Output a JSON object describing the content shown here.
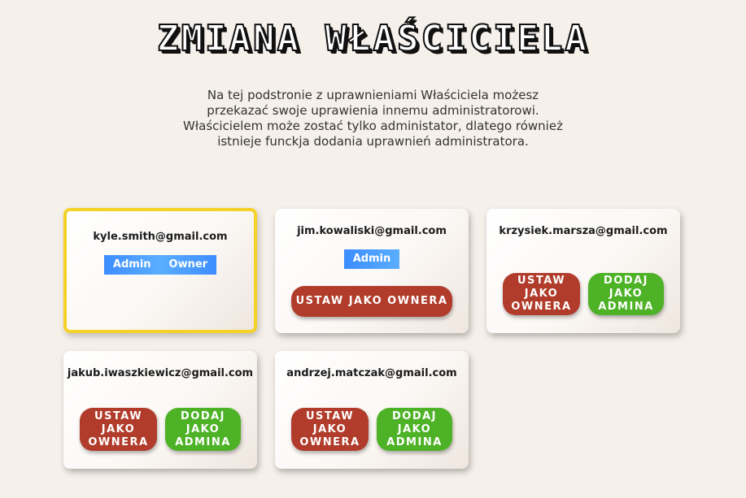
{
  "page": {
    "title": "ZMIANA WŁAŚCICIELA",
    "intro_lines": [
      "Na tej podstronie z uprawnieniami Właściciela możesz",
      "przekazać swoje uprawienia innemu administratorowi.",
      "Właścicielem może zostać tylko administator, dlatego również",
      "istnieje funckja dodania uprawnień administratora."
    ]
  },
  "colors": {
    "owner_border": "#f5d228",
    "set_owner_button": "#b13c2b",
    "add_admin_button": "#4db226",
    "badge": "#3d8dff"
  },
  "users": [
    {
      "email": "kyle.smith@gmail.com",
      "badges": [
        "Admin",
        "Owner"
      ],
      "is_owner": true
    },
    {
      "email": "jim.kowaliski@gmail.com",
      "badges": [
        "Admin"
      ],
      "set_owner_label": "USTAW JAKO OWNERA"
    },
    {
      "email": "krzysiek.marsza@gmail.com",
      "set_owner_label": "USTAW JAKO OWNERA",
      "add_admin_label": "DODAJ JAKO ADMINA"
    },
    {
      "email": "jakub.iwaszkiewicz@gmail.com",
      "set_owner_label": "USTAW JAKO OWNERA",
      "add_admin_label": "DODAJ JAKO ADMINA"
    },
    {
      "email": "andrzej.matczak@gmail.com",
      "set_owner_label": "USTAW JAKO OWNERA",
      "add_admin_label": "DODAJ JAKO ADMINA"
    }
  ]
}
